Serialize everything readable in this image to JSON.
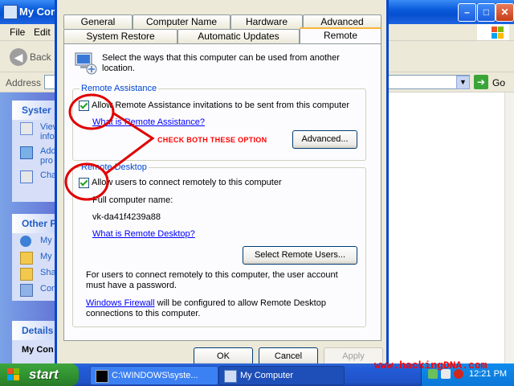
{
  "background_window": {
    "title": "My Com",
    "menu": [
      "File",
      "Edit"
    ],
    "back_label": "Back",
    "address_label": "Address",
    "go_label": "Go",
    "left_pane": {
      "system_tasks_title": "Syster",
      "system_items": [
        "View",
        "info",
        "Add",
        "pro",
        "Cha"
      ],
      "other_places_title": "Other P",
      "other_items": [
        "My",
        "My",
        "Sha",
        "Con"
      ],
      "details_title": "Details",
      "details_name": "My Con"
    }
  },
  "dialog": {
    "tabs_row1": [
      "General",
      "Computer Name",
      "Hardware",
      "Advanced"
    ],
    "tabs_row2": [
      "System Restore",
      "Automatic Updates",
      "Remote"
    ],
    "active_tab": "Remote",
    "intro_text": "Select the ways that this computer can be used from another location.",
    "remote_assistance": {
      "title": "Remote Assistance",
      "checkbox_label": "Allow Remote Assistance invitations to be sent from this computer",
      "checked": true,
      "help_link": "What is Remote Assistance?",
      "advanced_button": "Advanced..."
    },
    "remote_desktop": {
      "title": "Remote Desktop",
      "checkbox_label": "Allow users to connect remotely to this computer",
      "checked": true,
      "full_name_label": "Full computer name:",
      "computer_name": "vk-da41f4239a88",
      "help_link": "What is Remote Desktop?",
      "select_users_button": "Select Remote Users...",
      "note_text": "For users to connect remotely to this computer, the user account must have a password.",
      "firewall_link": "Windows Firewall",
      "firewall_text": " will be configured to allow Remote Desktop connections to this computer."
    },
    "buttons": {
      "ok": "OK",
      "cancel": "Cancel",
      "apply": "Apply"
    }
  },
  "annotation": {
    "text": "CHECK BOTH THESE OPTION",
    "color": "#ff0000"
  },
  "watermark": "www.hackingDNA.com",
  "taskbar": {
    "start_label": "start",
    "tasks": [
      "C:\\WINDOWS\\syste...",
      "My Computer"
    ],
    "clock": "12:21 PM"
  }
}
